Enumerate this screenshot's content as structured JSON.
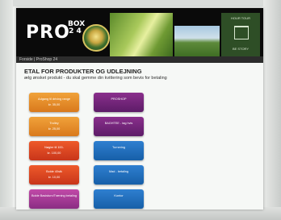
{
  "header": {
    "logo_main": "PRO",
    "logo_box": "BOX",
    "logo_num": "2 4",
    "top_right_line1": "HOUR TOUR",
    "top_right_line2": "BE STORY"
  },
  "nav": {
    "breadcrumb": "Forside  |  ProShop 24"
  },
  "page": {
    "title": "ETAL FOR PRODUKTER OG UDLEJNING",
    "subtitle": "ælg ønsket produkt - du skal gemme din kvittering som bevis for betaling"
  },
  "left_buttons": [
    {
      "label": "Adgang til driving range",
      "price": "kr. 35,00",
      "color": "orange"
    },
    {
      "label": "Trolley",
      "price": "kr. 25,00",
      "color": "orange"
    },
    {
      "label": "Nøgler til 100-",
      "price": "kr. 100,00",
      "color": "red"
    },
    {
      "label": "Bolde 40stk",
      "price": "kr. 10,00",
      "color": "red"
    },
    {
      "label": "Bolde Basisturn/Træning betaling",
      "price": "",
      "color": "magenta"
    }
  ],
  "right_buttons": [
    {
      "label": "PROSHOP",
      "price": "",
      "color": "purple"
    },
    {
      "label": "BAGHTEE - tag hvis",
      "price": "",
      "color": "purple"
    },
    {
      "label": "Turnering",
      "price": "",
      "color": "blue"
    },
    {
      "label": "Mad - betaling",
      "price": "",
      "color": "blue"
    },
    {
      "label": "Kontor",
      "price": "",
      "color": "blue"
    }
  ]
}
